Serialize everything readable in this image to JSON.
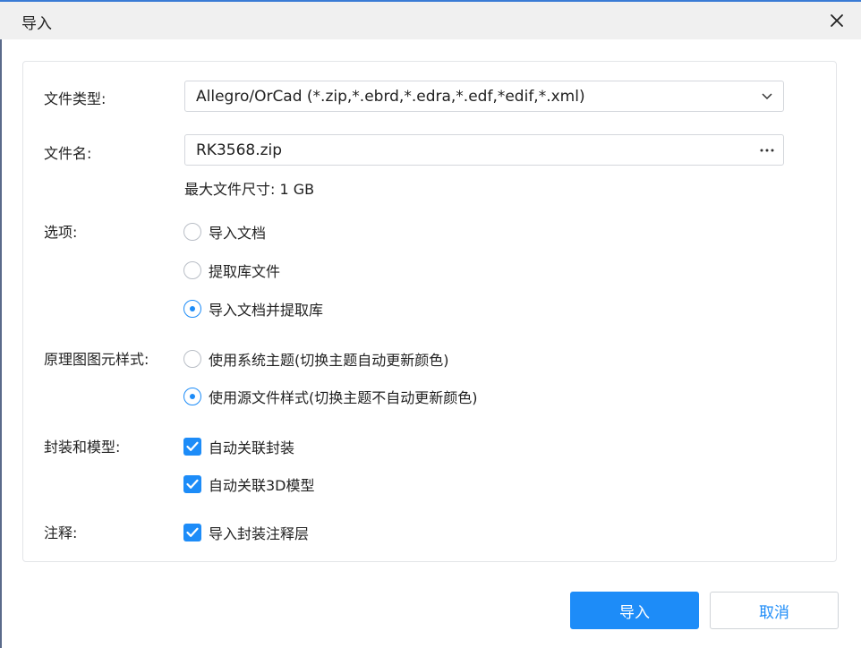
{
  "dialog": {
    "title": "导入",
    "close_icon": "close-icon"
  },
  "form": {
    "file_type": {
      "label": "文件类型:",
      "value": "Allegro/OrCad (*.zip,*.ebrd,*.edra,*.edf,*edif,*.xml)",
      "icon": "chevron-down-icon"
    },
    "file_name": {
      "label": "文件名:",
      "value": "RK3568.zip",
      "icon": "more-icon",
      "max_size_hint": "最大文件尺寸: 1 GB"
    },
    "options": {
      "label": "选项:",
      "items": [
        {
          "label": "导入文档",
          "selected": false
        },
        {
          "label": "提取库文件",
          "selected": false
        },
        {
          "label": "导入文档并提取库",
          "selected": true
        }
      ]
    },
    "schematic_style": {
      "label": "原理图图元样式:",
      "items": [
        {
          "label": "使用系统主题(切换主题自动更新颜色)",
          "selected": false
        },
        {
          "label": "使用源文件样式(切换主题不自动更新颜色)",
          "selected": true
        }
      ]
    },
    "footprint_model": {
      "label": "封装和模型:",
      "items": [
        {
          "label": "自动关联封装",
          "checked": true
        },
        {
          "label": "自动关联3D模型",
          "checked": true
        }
      ]
    },
    "annotation": {
      "label": "注释:",
      "items": [
        {
          "label": "导入封装注释层",
          "checked": true
        }
      ]
    }
  },
  "buttons": {
    "import": "导入",
    "cancel": "取消"
  },
  "colors": {
    "accent": "#1d8cf8",
    "titlebar_bg": "#f0f0f0",
    "border": "#d4d7dc"
  }
}
